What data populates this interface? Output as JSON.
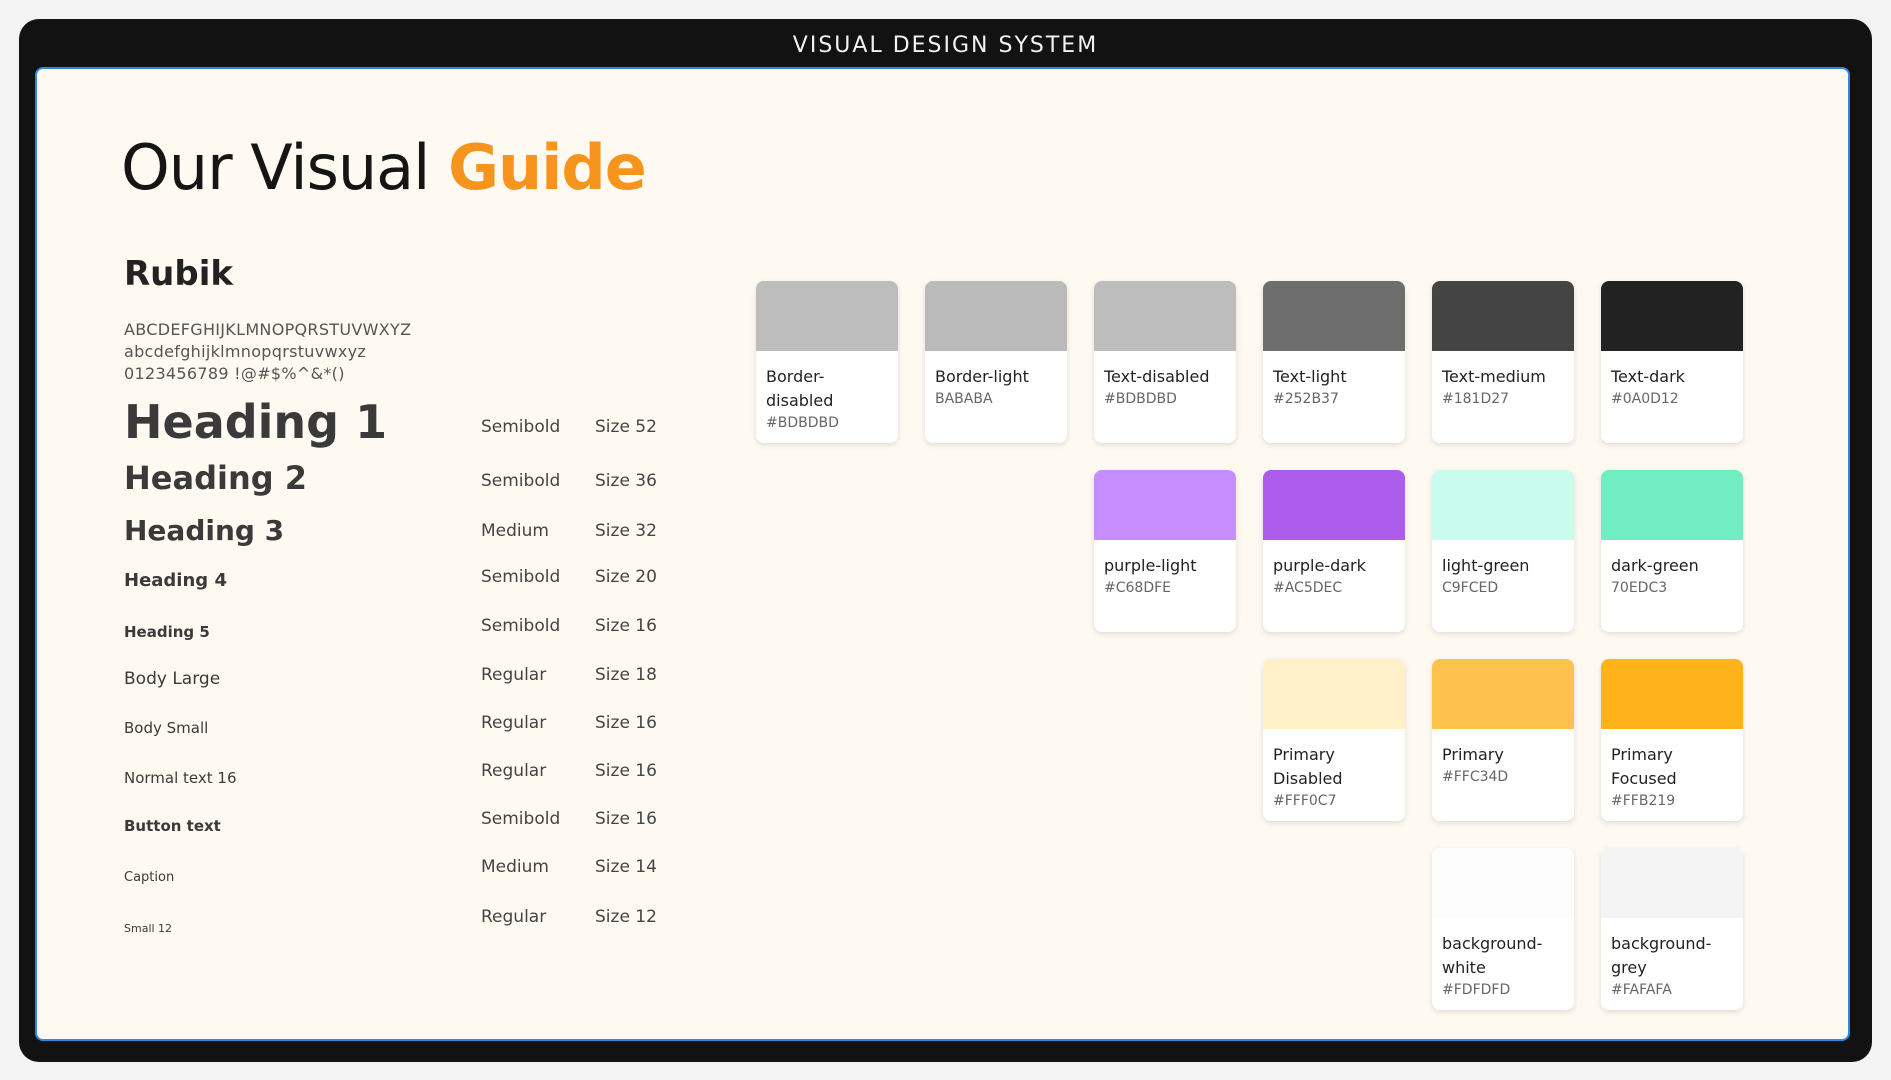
{
  "window": {
    "title": "VISUAL DESIGN SYSTEM"
  },
  "headline": {
    "part1": "Our Visual ",
    "part2": "Guide"
  },
  "typography": {
    "font_name": "Rubik",
    "charset": [
      "ABCDEFGHIJKLMNOPQRSTUVWXYZ",
      "abcdefghijklmnopqrstuvwxyz",
      "0123456789 !@#$%^&*()"
    ],
    "styles": [
      {
        "name": "Heading 1",
        "weight": "Semibold",
        "size": "Size 52"
      },
      {
        "name": "Heading 2",
        "weight": "Semibold",
        "size": "Size 36"
      },
      {
        "name": "Heading 3",
        "weight": "Medium",
        "size": "Size 32"
      },
      {
        "name": "Heading 4",
        "weight": "Semibold",
        "size": "Size 20"
      },
      {
        "name": "Heading 5",
        "weight": "Semibold",
        "size": "Size 16"
      },
      {
        "name": "Body Large",
        "weight": "Regular",
        "size": "Size 18"
      },
      {
        "name": "Body Small",
        "weight": "Regular",
        "size": "Size 16"
      },
      {
        "name": "Normal text 16",
        "weight": "Regular",
        "size": "Size 16"
      },
      {
        "name": "Button text",
        "weight": "Semibold",
        "size": "Size 16"
      },
      {
        "name": "Caption",
        "weight": "Medium",
        "size": "Size 14"
      },
      {
        "name": "Small 12",
        "weight": "Regular",
        "size": "Size 12"
      }
    ]
  },
  "colors": [
    {
      "name": "Border-disabled",
      "hex": "#BDBDBD",
      "color": "#BDBDBD"
    },
    {
      "name": "Border-light",
      "hex": "BABABA",
      "color": "#BABABA"
    },
    {
      "name": "Text-disabled",
      "hex": "#BDBDBD",
      "color": "#BDBDBD"
    },
    {
      "name": "Text-light",
      "hex": "#252B37",
      "color": "#6E6E6E"
    },
    {
      "name": "Text-medium",
      "hex": "#181D27",
      "color": "#444444"
    },
    {
      "name": "Text-dark",
      "hex": "#0A0D12",
      "color": "#222222"
    },
    {
      "name": "purple-light",
      "hex": "#C68DFE",
      "color": "#C68DFE"
    },
    {
      "name": "purple-dark",
      "hex": "#AC5DEC",
      "color": "#AC5DEC"
    },
    {
      "name": "light-green",
      "hex": "C9FCED",
      "color": "#C9FCED"
    },
    {
      "name": "dark-green",
      "hex": "70EDC3",
      "color": "#70EDC3"
    },
    {
      "name": "Primary Disabled",
      "hex": "#FFF0C7",
      "color": "#FFF0C7"
    },
    {
      "name": "Primary",
      "hex": "#FFC34D",
      "color": "#FFC34D"
    },
    {
      "name": "Primary Focused",
      "hex": "#FFB219",
      "color": "#FFB219"
    },
    {
      "name": "background-white",
      "hex": "#FDFDFD",
      "color": "#FDFDFD"
    },
    {
      "name": "background-grey",
      "hex": "#FAFAFA",
      "color": "#F4F4F4"
    }
  ]
}
